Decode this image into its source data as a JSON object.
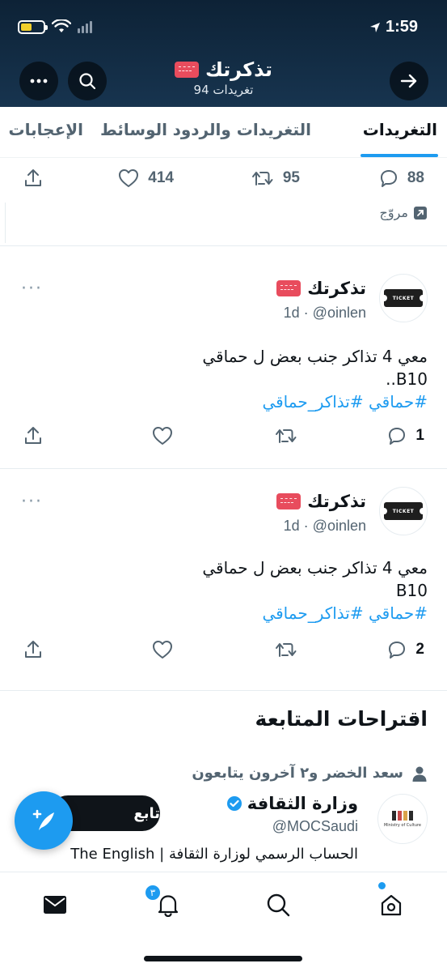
{
  "status_bar": {
    "time": "1:59"
  },
  "header": {
    "profile_name": "تذكرتك",
    "tweet_count": "94 تغريدات"
  },
  "tabs": [
    {
      "label": "التغريدات",
      "active": true
    },
    {
      "label": "التغريدات والردود",
      "active": false
    },
    {
      "label": "الوسائط",
      "active": false
    },
    {
      "label": "الإعجابات",
      "active": false
    }
  ],
  "top_tweet": {
    "replies": "88",
    "retweets": "95",
    "likes": "414",
    "promoted_label": "مروّج"
  },
  "tweets": [
    {
      "name": "تذكرتك",
      "meta": "1d · @oinlen",
      "more": "···",
      "line1": "معي 4 تذاكر جنب بعض ل حماقي",
      "line2": "B10..",
      "hashtags": "#حماقي #تذاكر_حماقي",
      "replies": "1",
      "avatar_text": "TICKET"
    },
    {
      "name": "تذكرتك",
      "meta": "1d · @oinlen",
      "more": "···",
      "line1": "معي 4 تذاكر جنب بعض ل حماقي",
      "line2": "B10",
      "hashtags": "#حماقي #تذاكر_حماقي",
      "replies": "2",
      "avatar_text": "TICKET"
    }
  ],
  "suggestions": {
    "title": "اقتراحات المتابعة",
    "context": "سعد الخضر و٢ آخرون يتابعون",
    "account_name": "وزارة الثقافة",
    "handle": "@MOCSaudi",
    "follow_label": "تابع",
    "bio": "الحساب الرسمي لوزارة الثقافة | The English",
    "avatar_caption": "Ministry of Culture"
  },
  "bottom_nav": {
    "notification_count": "٣"
  },
  "colors": {
    "accent": "#1d9bf0",
    "header_bg": "#17344f",
    "text": "#0f1419",
    "muted": "#536471"
  },
  "icons": [
    "back-arrow-icon",
    "search-icon",
    "more-icon",
    "reply-icon",
    "retweet-icon",
    "like-icon",
    "share-icon",
    "promoted-icon",
    "verified-icon",
    "compose-icon",
    "mail-icon",
    "bell-icon",
    "home-icon"
  ]
}
